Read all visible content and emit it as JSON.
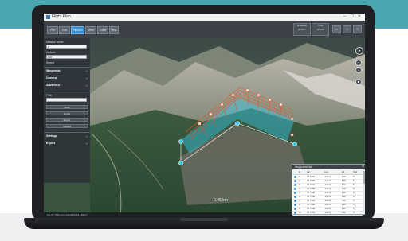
{
  "window": {
    "title": "Flight Plan"
  },
  "toolbar": {
    "buttons": [
      "File",
      "Edit",
      "Mission",
      "View",
      "Tools",
      "Help"
    ],
    "active_index": 2,
    "stats": [
      {
        "label": "Distance",
        "value": "2.4 km"
      },
      {
        "label": "Time",
        "value": "12 min"
      }
    ]
  },
  "sidepanel": {
    "field1_label": "Mission name",
    "field1_value": "1",
    "field2_label": "Altitude",
    "field2_value": "120",
    "field3_label": "Speed",
    "sections": [
      "Waypoints",
      "Camera",
      "Advanced"
    ],
    "field4_label": "Path",
    "buttons": [
      "Clear",
      "Import",
      "Export",
      "Upload"
    ],
    "sections2": [
      "Settings",
      "Export"
    ]
  },
  "map": {
    "scale_label": "0.45 km"
  },
  "waypoints_window": {
    "title": "Waypoints list",
    "columns": [
      "#",
      "Lat",
      "Lon",
      "Alt",
      "Spd"
    ],
    "rows": [
      [
        "1",
        "47.7251",
        "-122.9",
        "120",
        "5"
      ],
      [
        "2",
        "47.7262",
        "-122.9",
        "120",
        "5"
      ],
      [
        "3",
        "47.7274",
        "-122.9",
        "120",
        "5"
      ],
      [
        "4",
        "47.7285",
        "-122.9",
        "120",
        "5"
      ],
      [
        "5",
        "47.7296",
        "-122.9",
        "120",
        "5"
      ],
      [
        "6",
        "47.7308",
        "-122.9",
        "120",
        "5"
      ],
      [
        "7",
        "47.7319",
        "-122.9",
        "120",
        "5"
      ],
      [
        "8",
        "47.7330",
        "-122.9",
        "120",
        "5"
      ],
      [
        "9",
        "47.7342",
        "-122.9",
        "120",
        "5"
      ],
      [
        "10",
        "47.7353",
        "-122.9",
        "120",
        "5"
      ]
    ]
  },
  "statusbar": {
    "text": "Lat 47.7251  Lon -122.9012  Alt 1024 m"
  },
  "colors": {
    "accent": "#3b8fd0",
    "flight_path": "#e0572f",
    "coverage": "#34c9e8",
    "brand_band": "#4aa6b1"
  }
}
